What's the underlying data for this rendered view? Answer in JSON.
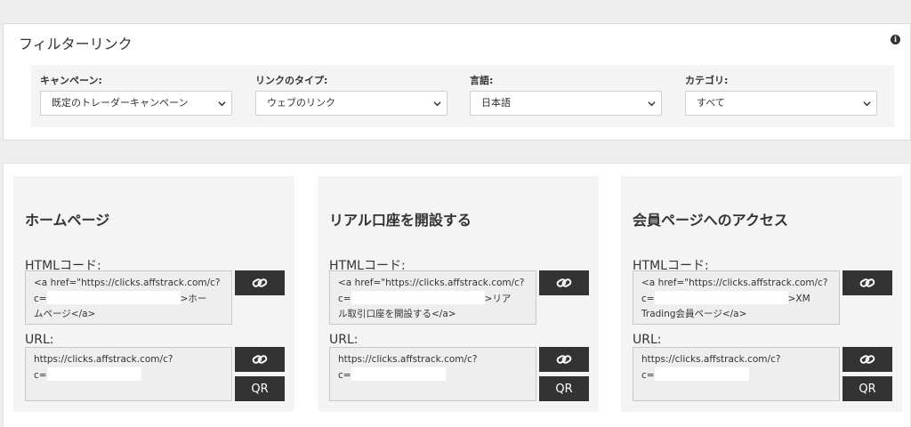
{
  "filter": {
    "title": "フィルターリンク",
    "info_icon": "info-icon",
    "groups": [
      {
        "label": "キャンペーン:",
        "value": "既定のトレーダーキャンペーン"
      },
      {
        "label": "リンクのタイプ:",
        "value": "ウェブのリンク"
      },
      {
        "label": "言語:",
        "value": "日本語"
      },
      {
        "label": "カテゴリ:",
        "value": "すべて"
      }
    ]
  },
  "cards": [
    {
      "title": "ホームページ",
      "html_label": "HTMLコード:",
      "html_line1": "<a href=\"https://clicks.affstrack.com/c?",
      "html_line2_prefix": "c=",
      "html_line2_suffix": ">ホー",
      "html_line3": "ムページ</a>",
      "url_label": "URL:",
      "url_line1": "https://clicks.affstrack.com/c?",
      "url_line2_prefix": "c=",
      "qr_label": "QR"
    },
    {
      "title": "リアル口座を開設する",
      "html_label": "HTMLコード:",
      "html_line1": "<a href=\"https://clicks.affstrack.com/c?",
      "html_line2_prefix": "c=",
      "html_line2_suffix": ">リア",
      "html_line3": "ル取引口座を開設する</a>",
      "url_label": "URL:",
      "url_line1": "https://clicks.affstrack.com/c?",
      "url_line2_prefix": "c=",
      "qr_label": "QR"
    },
    {
      "title": "会員ページへのアクセス",
      "html_label": "HTMLコード:",
      "html_line1": "<a href=\"https://clicks.affstrack.com/c?",
      "html_line2_prefix": "c=",
      "html_line2_suffix": ">XM",
      "html_line3": "Trading会員ページ</a>",
      "url_label": "URL:",
      "url_line1": "https://clicks.affstrack.com/c?",
      "url_line2_prefix": "c=",
      "qr_label": "QR"
    }
  ]
}
